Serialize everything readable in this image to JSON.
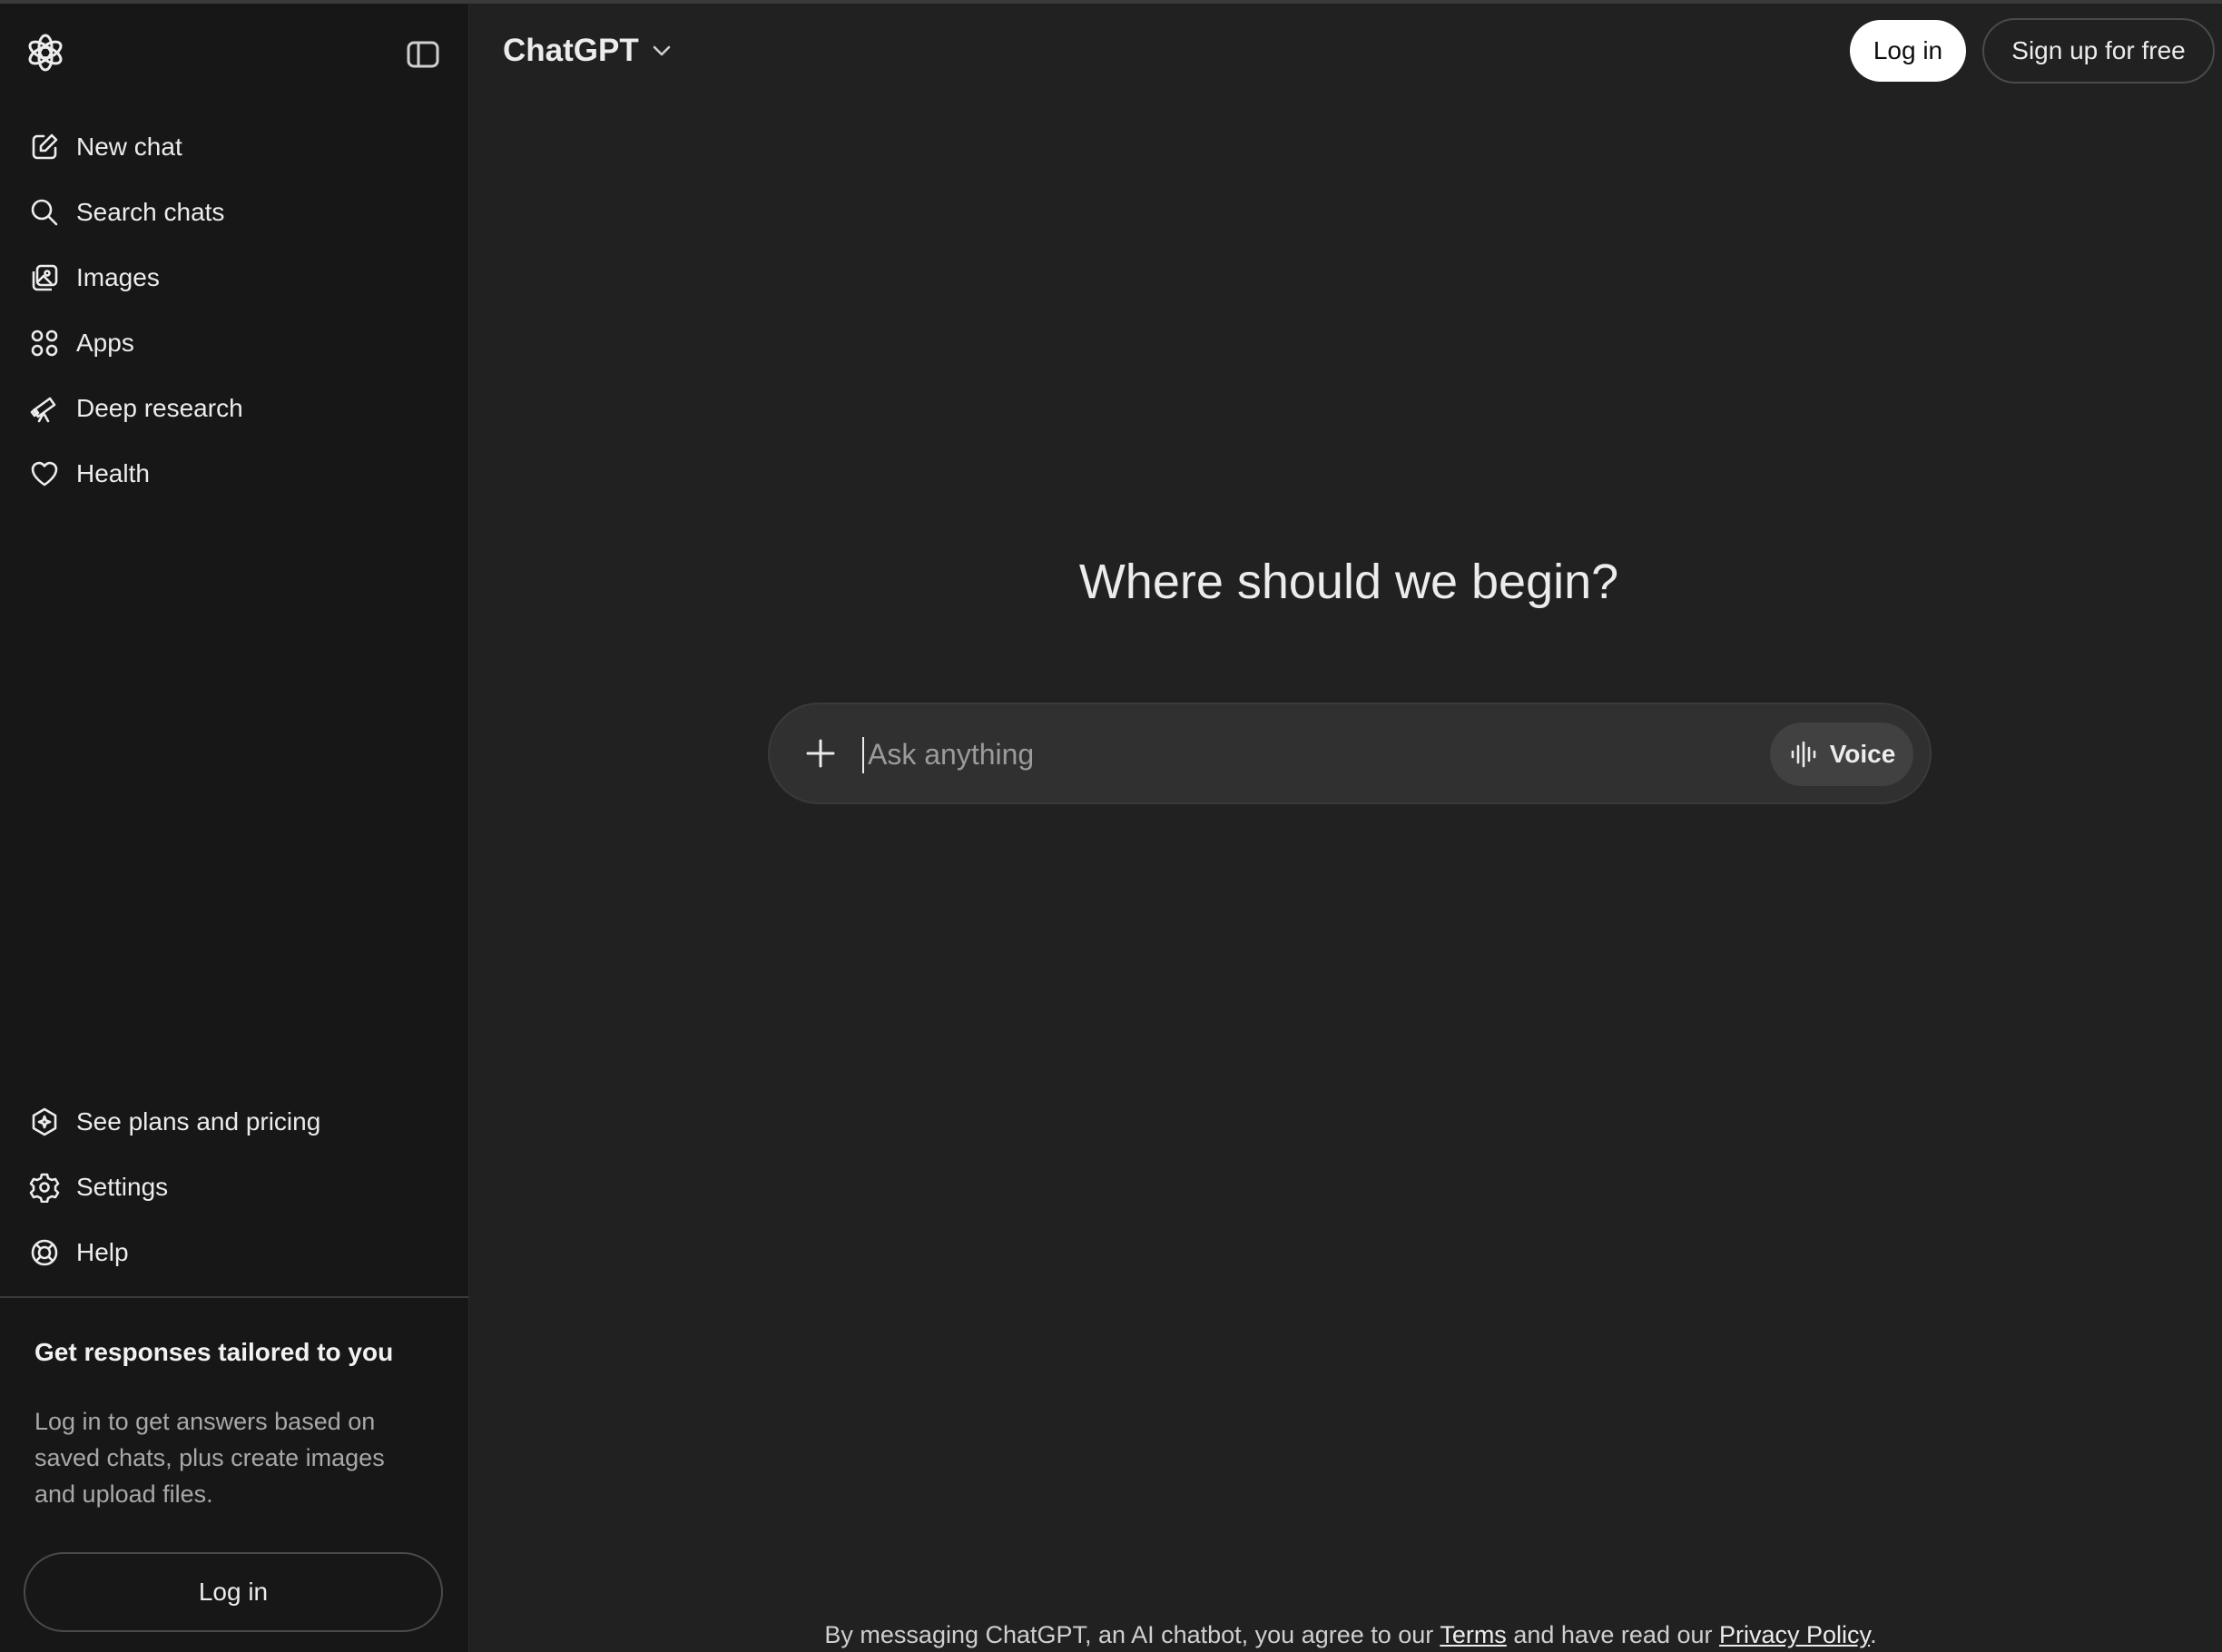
{
  "sidebar": {
    "items": [
      {
        "label": "New chat",
        "icon": "new-chat-icon"
      },
      {
        "label": "Search chats",
        "icon": "search-icon"
      },
      {
        "label": "Images",
        "icon": "images-icon"
      },
      {
        "label": "Apps",
        "icon": "apps-icon"
      },
      {
        "label": "Deep research",
        "icon": "telescope-icon"
      },
      {
        "label": "Health",
        "icon": "heart-icon"
      }
    ],
    "bottom_items": [
      {
        "label": "See plans and pricing",
        "icon": "plans-icon"
      },
      {
        "label": "Settings",
        "icon": "gear-icon"
      },
      {
        "label": "Help",
        "icon": "lifebuoy-icon"
      }
    ],
    "promo": {
      "title": "Get responses tailored to you",
      "text": "Log in to get answers based on saved chats, plus create images and upload files."
    },
    "login_label": "Log in"
  },
  "header": {
    "model": "ChatGPT",
    "login_label": "Log in",
    "signup_label": "Sign up for free"
  },
  "main": {
    "headline": "Where should we begin?",
    "composer": {
      "placeholder": "Ask anything",
      "voice_label": "Voice"
    },
    "disclaimer": {
      "prefix": "By messaging ChatGPT, an AI chatbot, you agree to our",
      "terms": "Terms",
      "middle": "and have read our",
      "privacy": "Privacy Policy",
      "suffix": "."
    }
  },
  "colors": {
    "background": "#212121",
    "sidebar": "#171717",
    "composer": "#303030",
    "text": "#ececec"
  }
}
